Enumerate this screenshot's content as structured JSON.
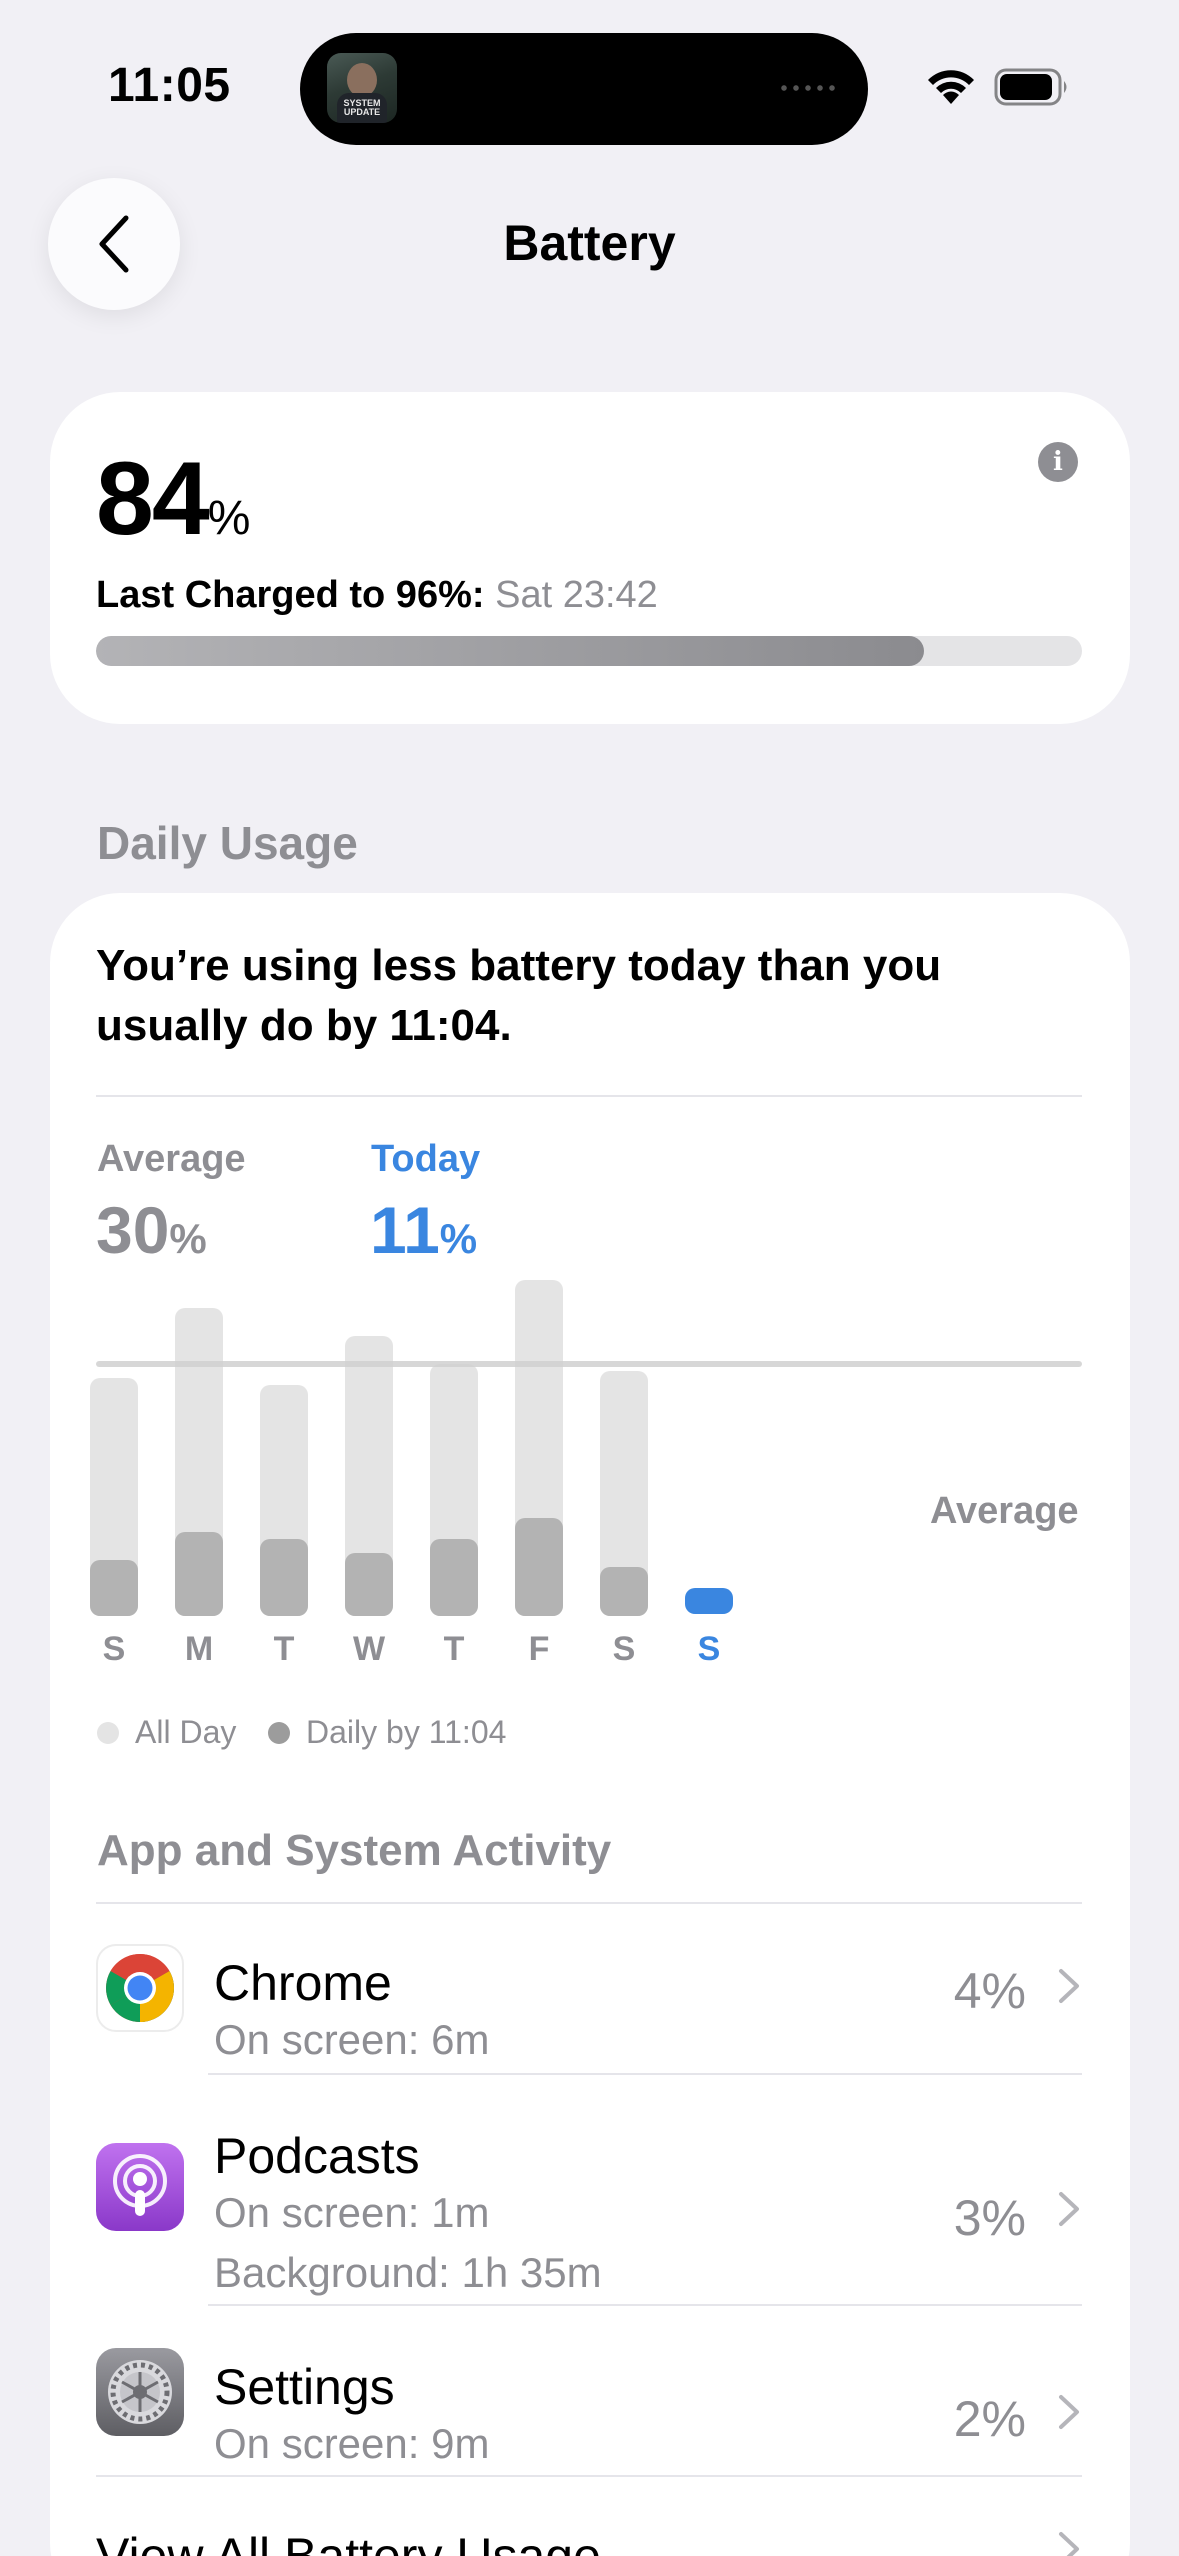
{
  "status_bar": {
    "time": "11:05",
    "activity_thumb_text": "SYSTEM UPDATE"
  },
  "nav": {
    "title": "Battery",
    "back_icon": "chevron-left-icon"
  },
  "battery": {
    "level_number": "84",
    "level_unit": "%",
    "level_fraction": 0.84,
    "last_charged_label": "Last Charged to 96%:",
    "last_charged_when": "Sat 23:42",
    "info_glyph": "i"
  },
  "daily_usage": {
    "section_title": "Daily Usage",
    "summary": "You’re using less battery today than you usually do by 11:04.",
    "average_label": "Average",
    "average_value": "30",
    "average_unit": "%",
    "today_label": "Today",
    "today_value": "11",
    "today_unit": "%",
    "average_line_label": "Average",
    "legend": {
      "all_day": "All Day",
      "daily_by": "Daily by 11:04"
    }
  },
  "chart_data": {
    "type": "bar",
    "categories": [
      "S",
      "M",
      "T",
      "W",
      "T",
      "F",
      "S",
      "S"
    ],
    "series": [
      {
        "name": "All Day",
        "values": [
          34,
          44,
          33,
          40,
          36,
          48,
          35,
          null
        ]
      },
      {
        "name": "Daily by 11:04",
        "values": [
          8,
          12,
          11,
          9,
          11,
          14,
          7,
          4
        ]
      }
    ],
    "average_line": 36,
    "highlight_index": 7,
    "colors": {
      "all_day": "#e4e4e4",
      "daily_by": "#b3b3b3",
      "today": "#3a86e0",
      "average_line": "#d0d0d0"
    }
  },
  "activity": {
    "section_title": "App and System Activity",
    "apps": [
      {
        "name": "Chrome",
        "lines": [
          "On screen: 6m"
        ],
        "percent": "4%",
        "icon": "chrome-icon"
      },
      {
        "name": "Podcasts",
        "lines": [
          "On screen: 1m",
          "Background: 1h 35m"
        ],
        "percent": "3%",
        "icon": "podcasts-icon"
      },
      {
        "name": "Settings",
        "lines": [
          "On screen: 9m"
        ],
        "percent": "2%",
        "icon": "settings-gear-icon"
      }
    ],
    "view_all": "View All Battery Usage"
  }
}
